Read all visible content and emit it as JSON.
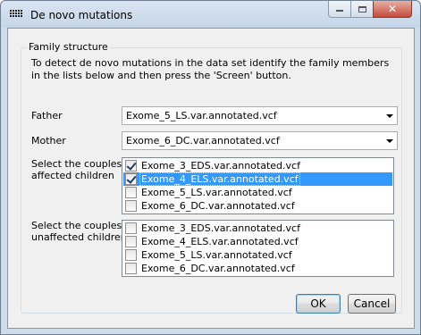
{
  "window": {
    "title": "De novo mutations",
    "icon": "dotted-grid-icon",
    "controls": [
      "minimize-icon",
      "maximize-icon",
      "close-icon"
    ]
  },
  "group": {
    "legend": "Family structure",
    "instructions": "To detect de novo mutations in the data set identify the family members in the lists below and then press the 'Screen' button."
  },
  "father": {
    "label": "Father",
    "selected": "Exome_5_LS.var.annotated.vcf"
  },
  "mother": {
    "label": "Mother",
    "selected": "Exome_6_DC.var.annotated.vcf"
  },
  "affected": {
    "label_line1": "Select the couples",
    "label_line2": "affected children",
    "items": [
      {
        "text": "Exome_3_EDS.var.annotated.vcf",
        "checked": true,
        "selected": false
      },
      {
        "text": "Exome_4_ELS.var.annotated.vcf",
        "checked": true,
        "selected": true
      },
      {
        "text": "Exome_5_LS.var.annotated.vcf",
        "checked": false,
        "selected": false
      },
      {
        "text": "Exome_6_DC.var.annotated.vcf",
        "checked": false,
        "selected": false
      }
    ]
  },
  "unaffected": {
    "label_line1": "Select the couples",
    "label_line2": "unaffected children",
    "items": [
      {
        "text": "Exome_3_EDS.var.annotated.vcf",
        "checked": false,
        "selected": false
      },
      {
        "text": "Exome_4_ELS.var.annotated.vcf",
        "checked": false,
        "selected": false
      },
      {
        "text": "Exome_5_LS.var.annotated.vcf",
        "checked": false,
        "selected": false
      },
      {
        "text": "Exome_6_DC.var.annotated.vcf",
        "checked": false,
        "selected": false
      }
    ]
  },
  "buttons": {
    "ok": "OK",
    "cancel": "Cancel"
  },
  "colors": {
    "selection": "#3399ff",
    "frame": "#cfdcea",
    "close_button": "#c64b3a"
  }
}
